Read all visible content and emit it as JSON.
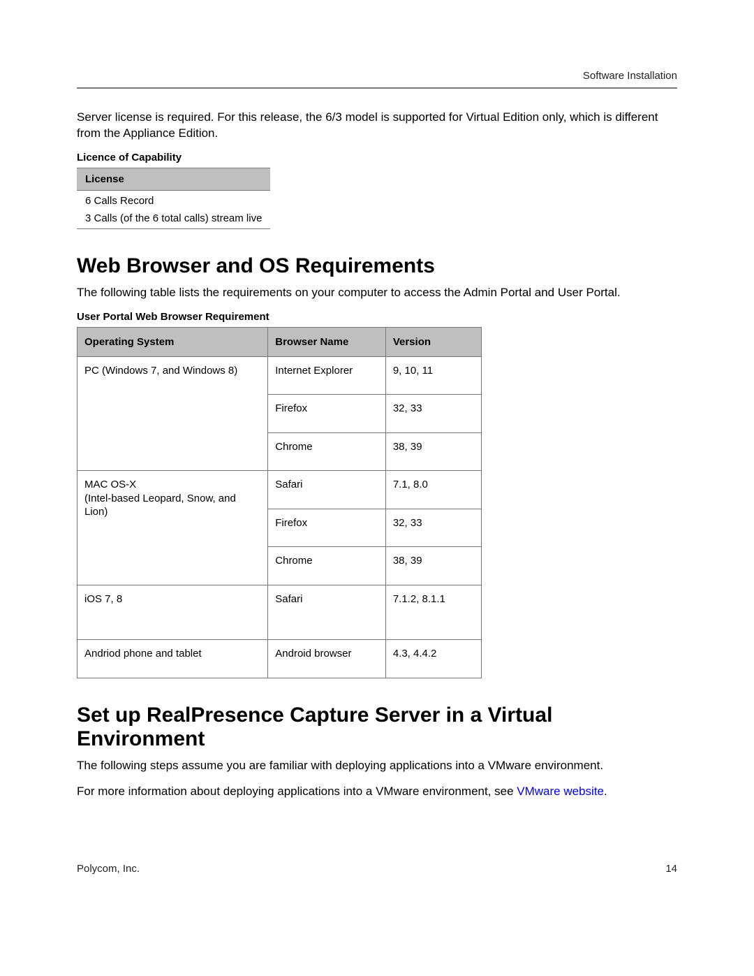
{
  "header": {
    "section": "Software Installation"
  },
  "intro_para": "Server license is required. For this release, the 6/3 model is supported for Virtual Edition only, which is different from the Appliance Edition.",
  "license": {
    "caption": "Licence of Capability",
    "header": "License",
    "rows": [
      "6 Calls Record",
      "3 Calls (of the 6 total calls) stream live"
    ]
  },
  "section1": {
    "title": "Web Browser and OS Requirements",
    "para": "The following table lists the requirements on your computer to access the Admin Portal and User Portal.",
    "table_caption": "User Portal Web Browser Requirement",
    "columns": {
      "os": "Operating System",
      "browser": "Browser Name",
      "version": "Version"
    },
    "rows": [
      {
        "os": "PC (Windows 7, and Windows 8)",
        "browser": "Internet Explorer",
        "version": "9, 10, 11",
        "span": 3
      },
      {
        "os": "",
        "browser": "Firefox",
        "version": "32, 33"
      },
      {
        "os": "",
        "browser": "Chrome",
        "version": "38, 39"
      },
      {
        "os": "MAC OS-X\n(Intel-based Leopard, Snow, and Lion)",
        "browser": "Safari",
        "version": "7.1, 8.0",
        "span": 3
      },
      {
        "os": "",
        "browser": "Firefox",
        "version": "32, 33"
      },
      {
        "os": "",
        "browser": "Chrome",
        "version": "38, 39"
      },
      {
        "os": "iOS 7, 8",
        "browser": "Safari",
        "version": "7.1.2, 8.1.1",
        "span": 1,
        "tall": true
      },
      {
        "os": "Andriod phone and tablet",
        "browser": "Android browser",
        "version": "4.3, 4.4.2",
        "span": 1
      }
    ]
  },
  "section2": {
    "title": "Set up RealPresence Capture Server in a Virtual Environment",
    "para1": "The following steps assume you are familiar with deploying applications into a VMware environment.",
    "para2_pre": "For more information about deploying applications into a VMware environment, see ",
    "para2_link": "VMware website",
    "para2_post": "."
  },
  "footer": {
    "left": "Polycom, Inc.",
    "right": "14"
  }
}
